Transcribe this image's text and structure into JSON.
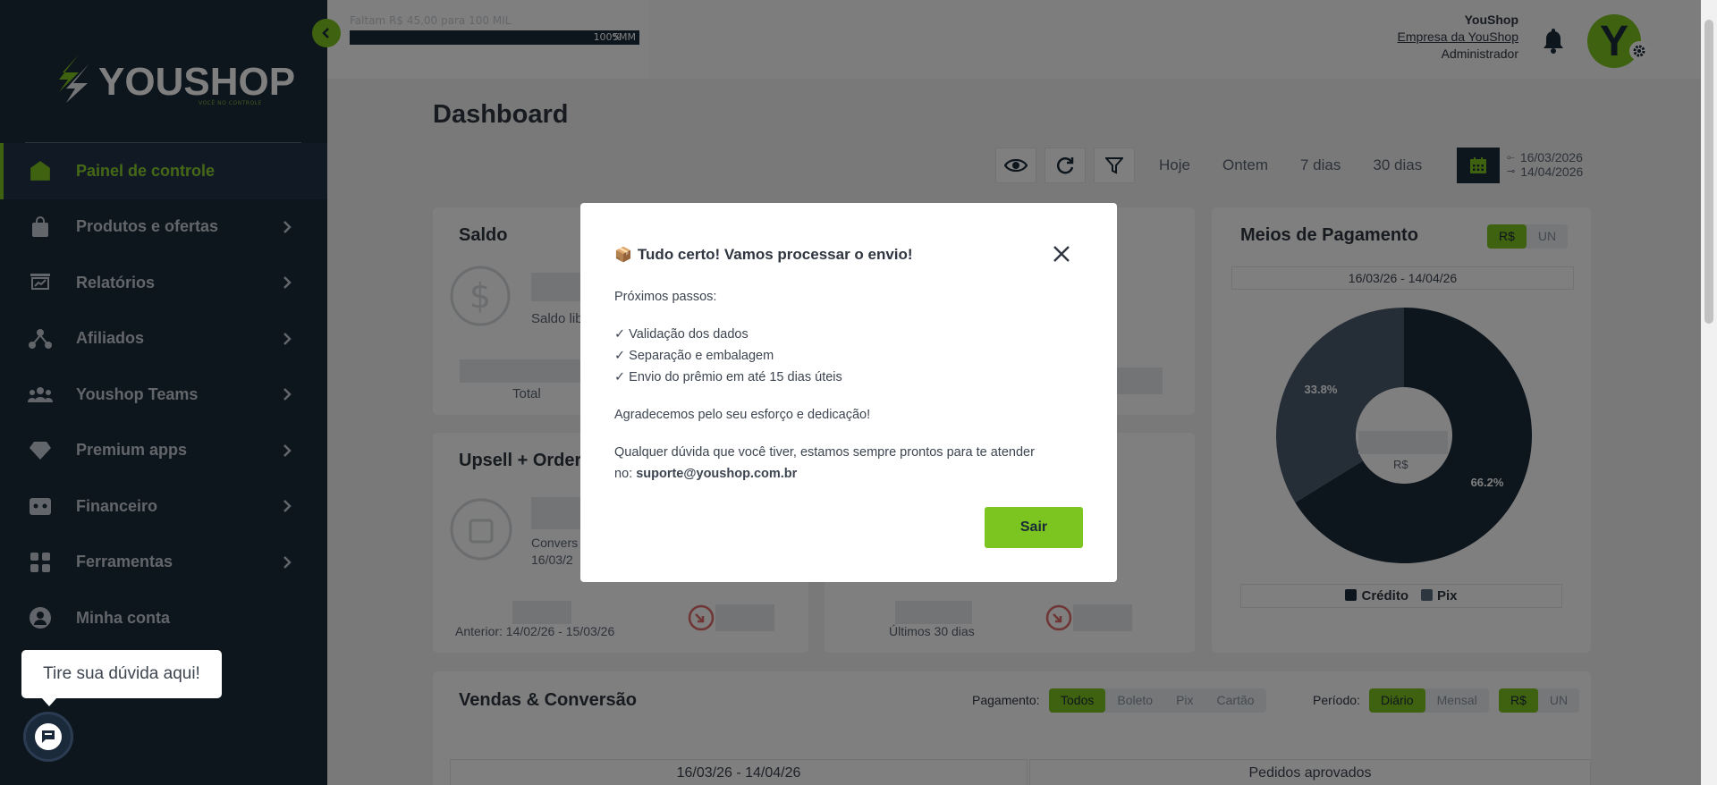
{
  "brand": {
    "name": "YOUSHOP",
    "tagline": "VOCÊ NO CONTROLE",
    "accent": "#7cc41f",
    "navy": "#1b2a3a"
  },
  "sidebar": {
    "items": [
      {
        "label": "Painel de controle",
        "icon": "home-icon",
        "active": true
      },
      {
        "label": "Produtos e ofertas",
        "icon": "shopping-bag-icon"
      },
      {
        "label": "Relatórios",
        "icon": "report-icon"
      },
      {
        "label": "Afiliados",
        "icon": "affiliates-icon"
      },
      {
        "label": "Youshop Teams",
        "icon": "teams-icon"
      },
      {
        "label": "Premium apps",
        "icon": "diamond-icon"
      },
      {
        "label": "Financeiro",
        "icon": "wallet-icon"
      },
      {
        "label": "Ferramentas",
        "icon": "grid-icon"
      },
      {
        "label": "Minha conta",
        "icon": "user-circle-icon"
      }
    ]
  },
  "header": {
    "progress_text": "Faltam R$ 45,00 para 100 MIL",
    "progress_label": "100%",
    "progress_label_2": "5MM",
    "user_name": "YouShop",
    "company": "Empresa da YouShop",
    "role": "Administrador",
    "avatar_letter": "Y"
  },
  "main": {
    "title": "Dashboard",
    "periods": [
      "Hoje",
      "Ontem",
      "7 dias",
      "30 dias"
    ],
    "date_from": "16/03/2026",
    "date_to": "14/04/2026",
    "saldo": {
      "title": "Saldo",
      "sub": "Saldo lib",
      "total": "Total"
    },
    "upsell": {
      "title": "Upsell + Order",
      "sub1": "Convers",
      "sub2": "16/03/2",
      "anterior": "Anterior: 14/02/26 - 15/03/26",
      "ultimos": "Últimos 30 dias"
    },
    "meios": {
      "title": "Meios de Pagamento",
      "toggle": [
        "R$",
        "UN"
      ],
      "range": "16/03/26 - 14/04/26",
      "center": "R$",
      "legend": [
        "Crédito",
        "Pix"
      ]
    },
    "vendas": {
      "title": "Vendas & Conversão",
      "pagamento_label": "Pagamento:",
      "pagamento": [
        "Todos",
        "Boleto",
        "Pix",
        "Cartão"
      ],
      "periodo_label": "Período:",
      "periodo": [
        "Diário",
        "Mensal"
      ],
      "unit": [
        "R$",
        "UN"
      ],
      "range": "16/03/26 - 14/04/26",
      "pedidos": "Pedidos aprovados"
    }
  },
  "chart_data": {
    "type": "pie",
    "title": "Meios de Pagamento",
    "categories": [
      "Crédito",
      "Pix"
    ],
    "values": [
      66.2,
      33.8
    ],
    "labels": [
      "66.2%",
      "33.8%"
    ],
    "colors": [
      "#1b2a3a",
      "#4a5a6e"
    ],
    "legend": "bottom"
  },
  "modal": {
    "emoji": "📦",
    "title": "Tudo certo! Vamos processar o envio!",
    "intro": "Próximos passos:",
    "steps": [
      "✓ Validação dos dados",
      "✓ Separação e embalagem",
      "✓ Envio do prêmio em até 15 dias úteis"
    ],
    "thanks": "Agradecemos pelo seu esforço e dedicação!",
    "contact_line": "Qualquer dúvida que você tiver, estamos sempre prontos para te atender",
    "contact_prefix": "no:",
    "email": "suporte@youshop.com.br",
    "button": "Sair"
  },
  "help": {
    "bubble": "Tire sua dúvida aqui!"
  }
}
